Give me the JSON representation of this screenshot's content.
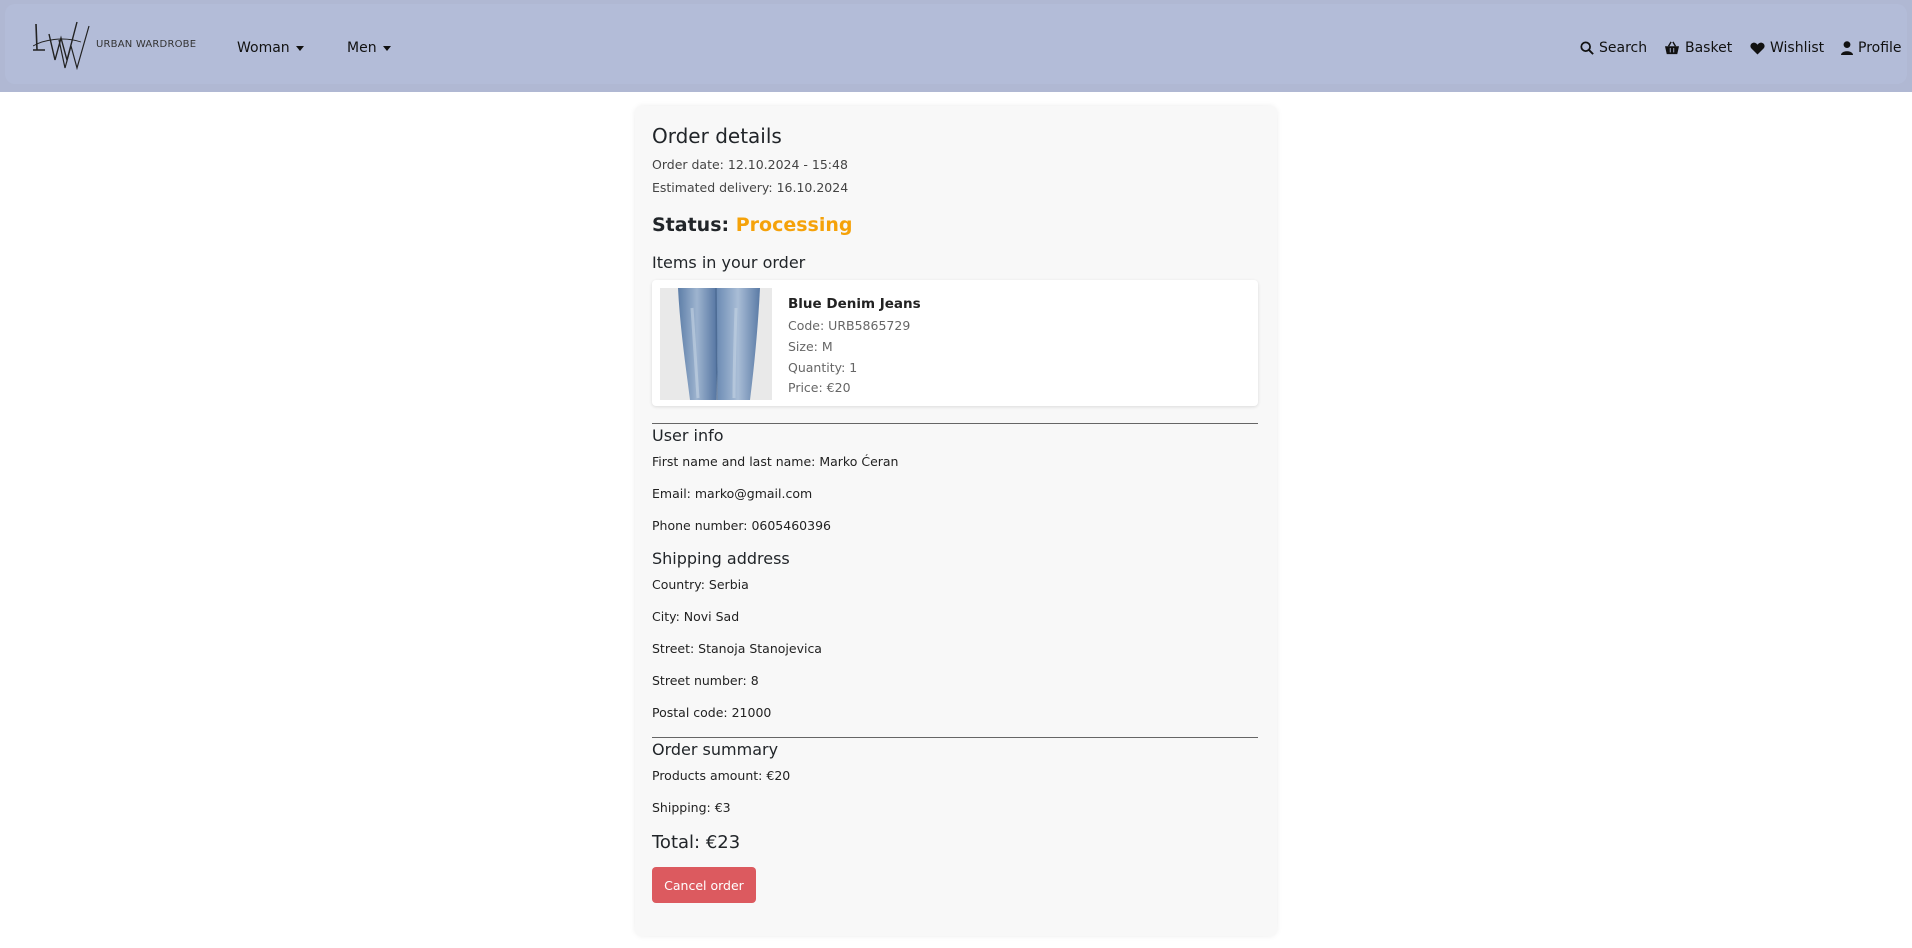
{
  "navbar": {
    "logo_text": "URBAN WARDROBE",
    "menu": [
      {
        "label": "Woman"
      },
      {
        "label": "Men"
      }
    ],
    "actions": {
      "search": "Search",
      "basket": "Basket",
      "wishlist": "Wishlist",
      "profile": "Profile"
    }
  },
  "order": {
    "title": "Order details",
    "order_date": "Order date: 12.10.2024 - 15:48",
    "estimated_delivery": "Estimated delivery: 16.10.2024",
    "status_label": "Status:",
    "status_value": "Processing",
    "status_color": "#f5a20a",
    "items_heading": "Items in your order",
    "items": [
      {
        "name": "Blue Denim Jeans",
        "code": "Code: URB5865729",
        "size": "Size: M",
        "quantity": "Quantity: 1",
        "price": "Price: €20"
      }
    ],
    "user_info": {
      "heading": "User info",
      "name": "First name and last name: Marko Ćeran",
      "email": "Email: marko@gmail.com",
      "phone": "Phone number: 0605460396"
    },
    "shipping": {
      "heading": "Shipping address",
      "country": "Country: Serbia",
      "city": "City: Novi Sad",
      "street": "Street: Stanoja Stanojevica",
      "street_number": "Street number: 8",
      "postal_code": "Postal code: 21000"
    },
    "summary": {
      "heading": "Order summary",
      "products_amount": "Products amount: €20",
      "shipping": "Shipping: €3",
      "total": "Total: €23"
    },
    "cancel_label": "Cancel order",
    "cancel_color": "#dc5a5f"
  }
}
